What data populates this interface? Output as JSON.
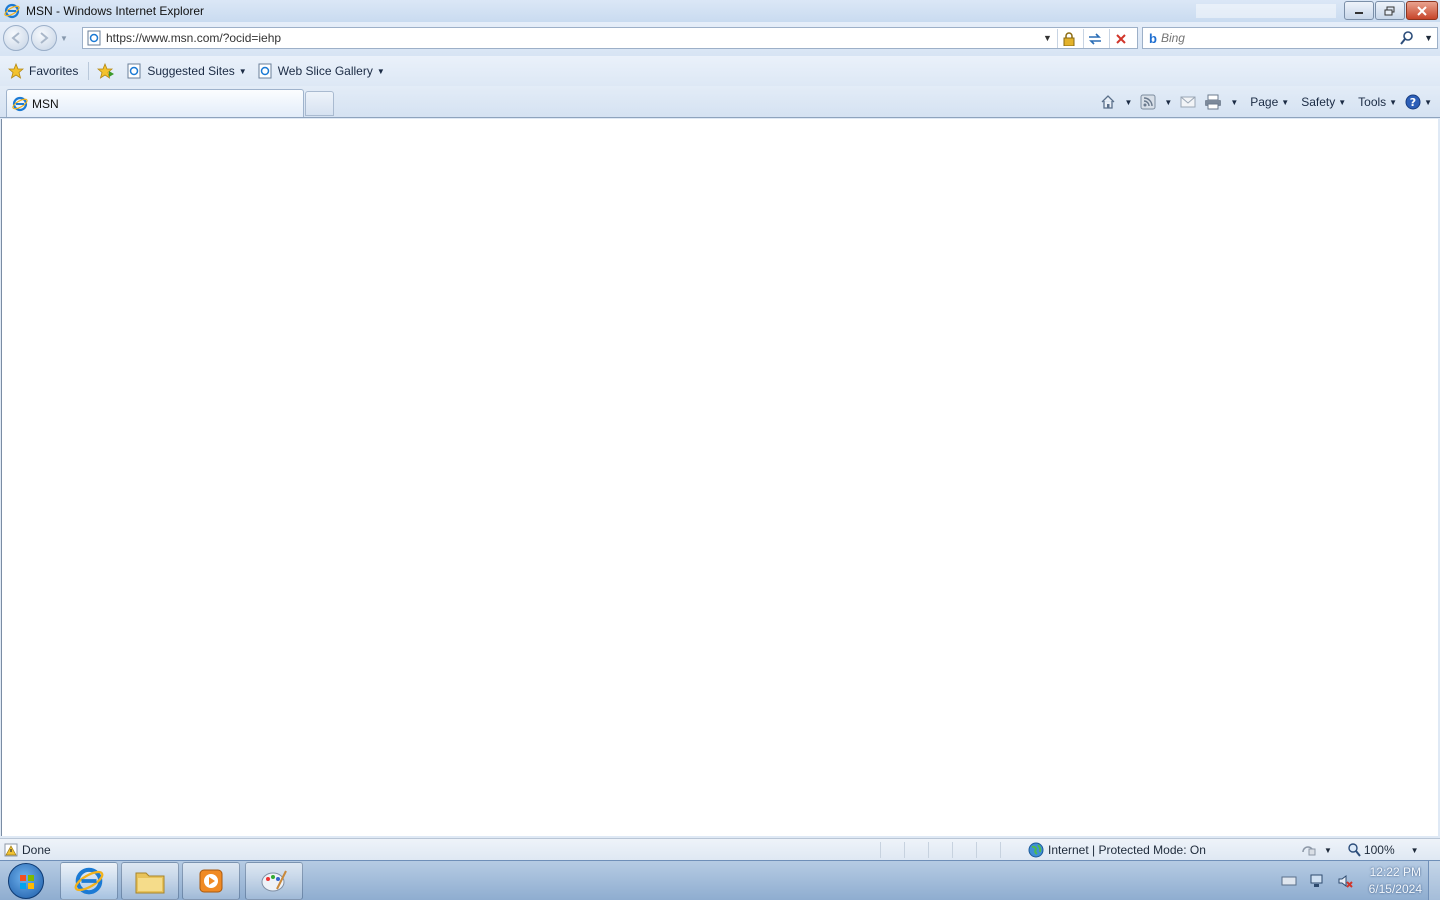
{
  "window": {
    "title": "MSN - Windows Internet Explorer"
  },
  "address": {
    "url": "https://www.msn.com/?ocid=iehp"
  },
  "search": {
    "provider": "b",
    "placeholder": "Bing"
  },
  "favorites_bar": {
    "favorites_label": "Favorites",
    "items": [
      {
        "label": "Suggested Sites"
      },
      {
        "label": "Web Slice Gallery"
      }
    ]
  },
  "tabs": [
    {
      "label": "MSN"
    }
  ],
  "command_bar": {
    "page_label": "Page",
    "safety_label": "Safety",
    "tools_label": "Tools"
  },
  "status": {
    "text": "Done",
    "zone": "Internet | Protected Mode: On",
    "zoom": "100%"
  },
  "taskbar": {
    "time": "12:22 PM",
    "date": "6/15/2024"
  },
  "colors": {
    "chrome_light": "#dfe9f5",
    "chrome_border": "#8ea3bd",
    "taskbar": "#8fadd0",
    "close_button": "#c7452a"
  }
}
